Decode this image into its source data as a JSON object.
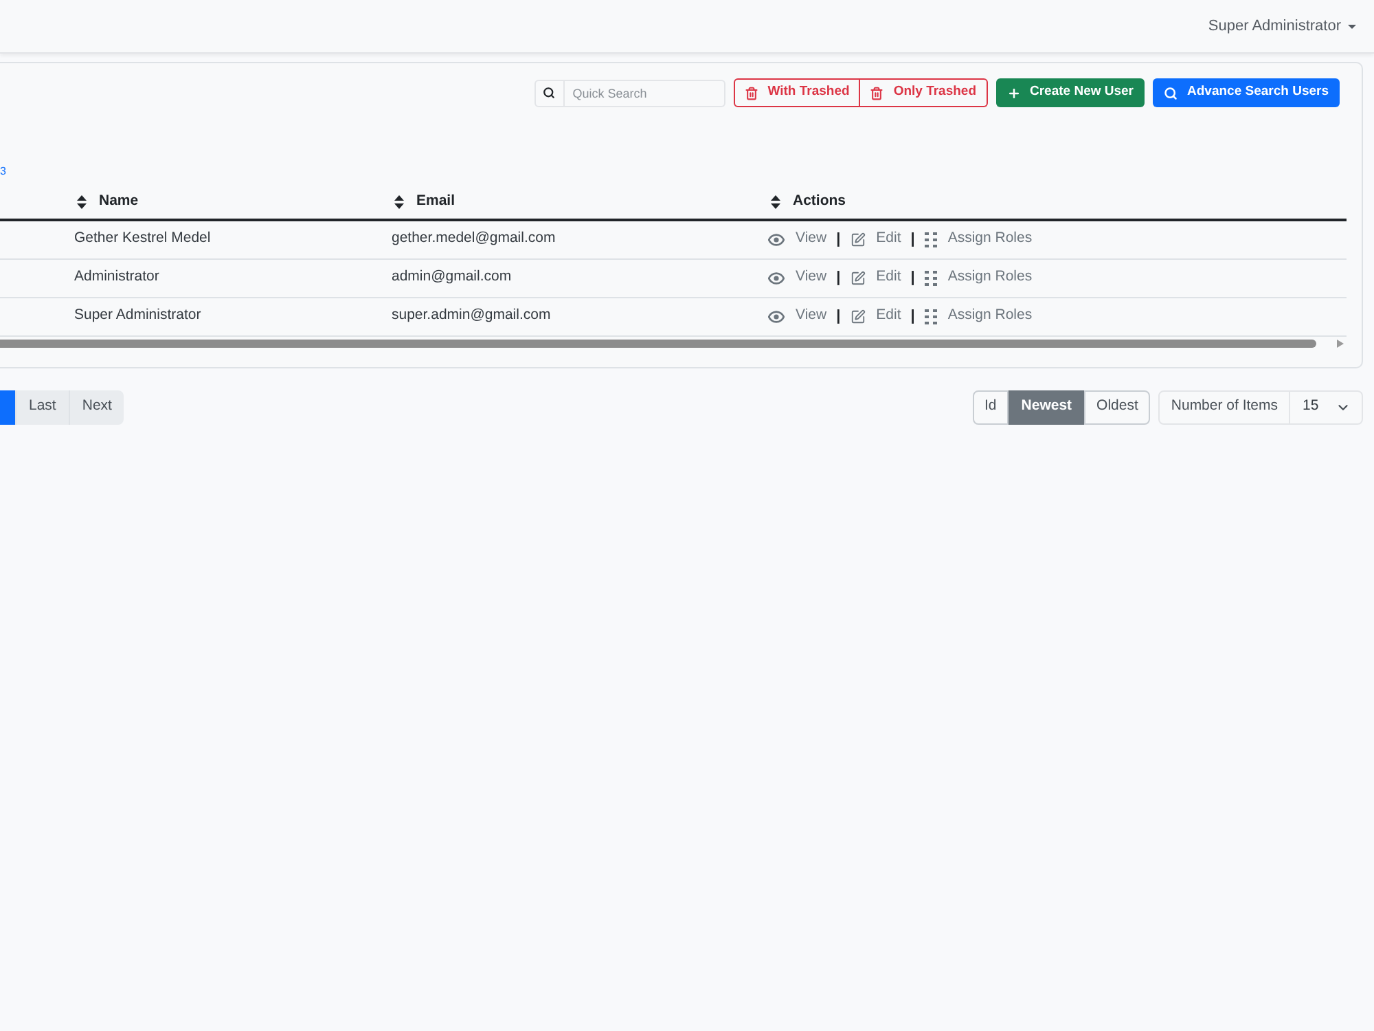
{
  "navbar": {
    "user_menu": "Super Administrator"
  },
  "toolbar": {
    "search": {
      "placeholder": "Quick Search"
    },
    "trash_filters": [
      {
        "label": "With Trashed",
        "selected": false
      },
      {
        "label": "Only Trashed",
        "selected": false
      }
    ],
    "buttons": [
      {
        "kind": "create",
        "label": "Create New User"
      },
      {
        "kind": "advanced_search",
        "label": "Advance Search Users"
      }
    ]
  },
  "summary_fragment": "3",
  "table": {
    "columns": [
      "Name",
      "Email",
      "Actions"
    ],
    "rows": [
      {
        "name": "Gether Kestrel Medel",
        "email": "gether.medel@gmail.com",
        "actions": [
          {
            "kind": "view",
            "label": "View"
          },
          {
            "kind": "separator",
            "label": "|"
          },
          {
            "kind": "edit",
            "label": "Edit"
          },
          {
            "kind": "separator",
            "label": "|"
          },
          {
            "kind": "roles",
            "label": "Assign Roles"
          }
        ]
      },
      {
        "name": "Administrator",
        "email": "admin@gmail.com",
        "actions": [
          {
            "kind": "view",
            "label": "View"
          },
          {
            "kind": "separator",
            "label": "|"
          },
          {
            "kind": "edit",
            "label": "Edit"
          },
          {
            "kind": "separator",
            "label": "|"
          },
          {
            "kind": "roles",
            "label": "Assign Roles"
          }
        ]
      },
      {
        "name": "Super Administrator",
        "email": "super.admin@gmail.com",
        "actions": [
          {
            "kind": "view",
            "label": "View"
          },
          {
            "kind": "separator",
            "label": "|"
          },
          {
            "kind": "edit",
            "label": "Edit"
          },
          {
            "kind": "separator",
            "label": "|"
          },
          {
            "kind": "roles",
            "label": "Assign Roles"
          }
        ]
      }
    ]
  },
  "pagination": [
    {
      "kind": "page",
      "selected": true
    },
    {
      "kind": "nav",
      "label": "Last",
      "selected": false
    },
    {
      "kind": "nav",
      "label": "Next",
      "selected": false
    }
  ],
  "sort_options": [
    {
      "label": "Id",
      "selected": false
    },
    {
      "label": "Newest",
      "selected": true
    },
    {
      "label": "Oldest",
      "selected": false
    }
  ],
  "items_per_page": {
    "label": "Number of Items",
    "value": "15"
  }
}
